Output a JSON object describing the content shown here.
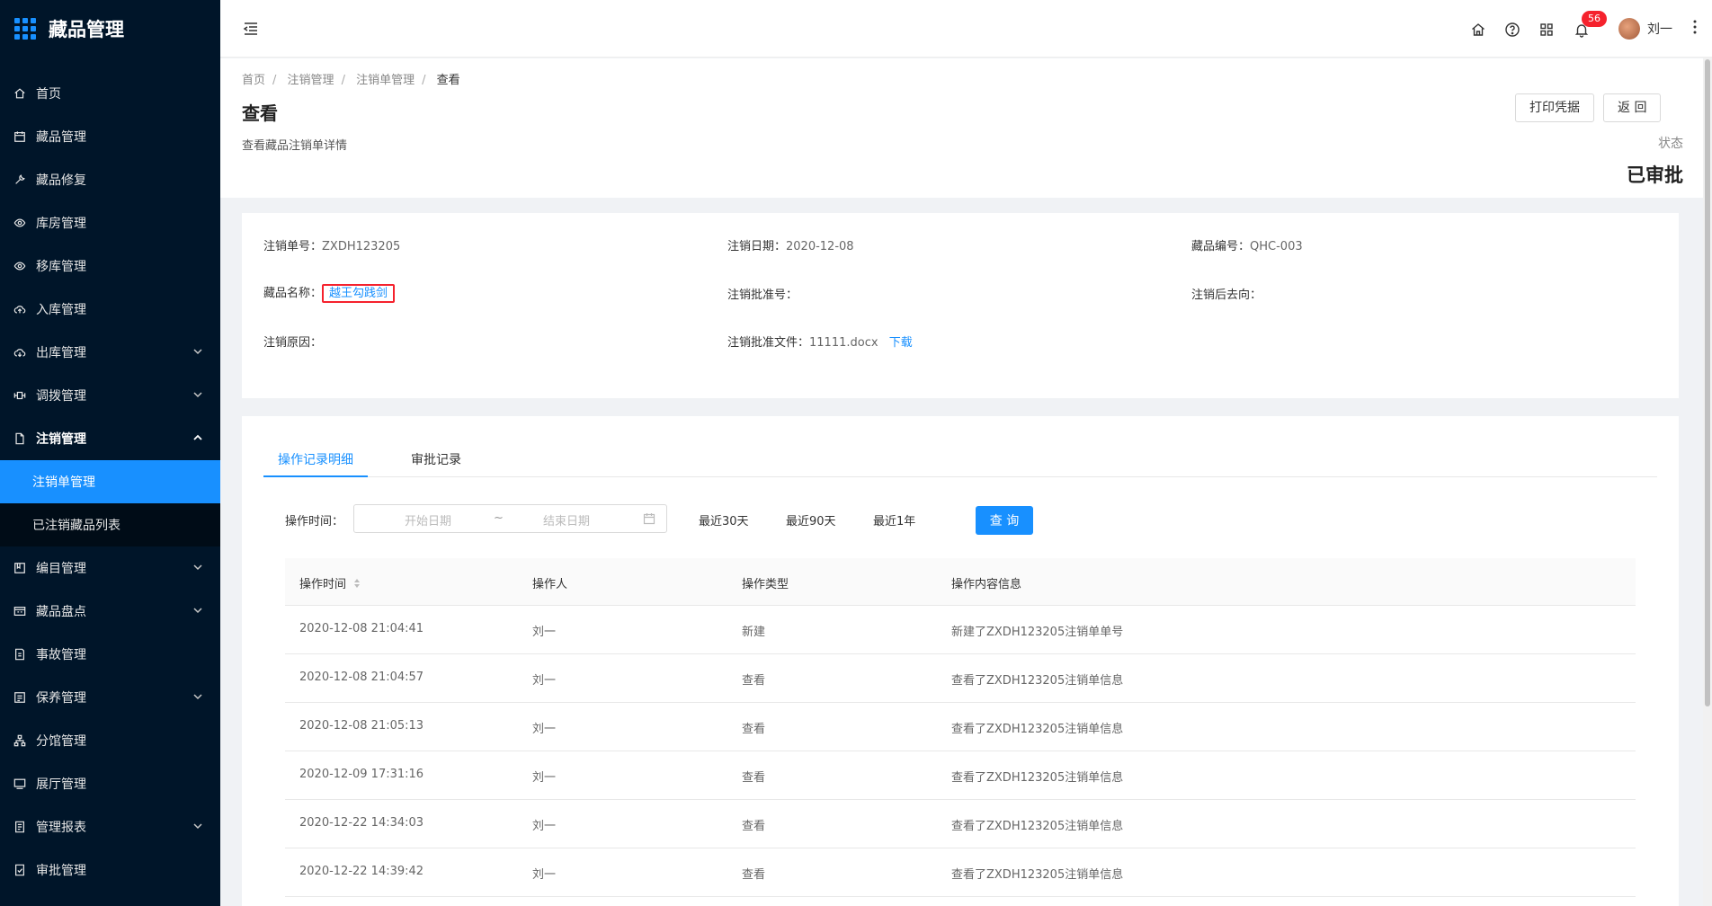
{
  "app": {
    "title": "藏品管理"
  },
  "sidebar": {
    "items": [
      {
        "label": "首页",
        "icon": "home-icon"
      },
      {
        "label": "藏品管理",
        "icon": "calendar-icon"
      },
      {
        "label": "藏品修复",
        "icon": "wrench-icon"
      },
      {
        "label": "库房管理",
        "icon": "eye-icon"
      },
      {
        "label": "移库管理",
        "icon": "eye-icon"
      },
      {
        "label": "入库管理",
        "icon": "cloud-upload-icon"
      },
      {
        "label": "出库管理",
        "icon": "cloud-download-icon",
        "arrow": "down"
      },
      {
        "label": "调拨管理",
        "icon": "swap-icon",
        "arrow": "down"
      },
      {
        "label": "注销管理",
        "icon": "file-icon",
        "arrow": "up"
      }
    ],
    "submenu": [
      {
        "label": "注销单管理",
        "active": true
      },
      {
        "label": "已注销藏品列表"
      }
    ],
    "items_after": [
      {
        "label": "编目管理",
        "icon": "catalog-icon",
        "arrow": "down"
      },
      {
        "label": "藏品盘点",
        "icon": "inventory-icon",
        "arrow": "down"
      },
      {
        "label": "事故管理",
        "icon": "accident-icon"
      },
      {
        "label": "保养管理",
        "icon": "maintenance-icon",
        "arrow": "down"
      },
      {
        "label": "分馆管理",
        "icon": "branch-icon"
      },
      {
        "label": "展厅管理",
        "icon": "hall-icon"
      },
      {
        "label": "管理报表",
        "icon": "report-icon",
        "arrow": "down"
      },
      {
        "label": "审批管理",
        "icon": "approval-icon"
      }
    ]
  },
  "header": {
    "notification_count": "56",
    "username": "刘一"
  },
  "breadcrumb": [
    "首页",
    "注销管理",
    "注销单管理",
    "查看"
  ],
  "page": {
    "title": "查看",
    "description": "查看藏品注销单详情",
    "print_label": "打印凭据",
    "back_label": "返 回",
    "status_label": "状态",
    "status_value": "已审批"
  },
  "detail": {
    "order_no_label": "注销单号：",
    "order_no": "ZXDH123205",
    "date_label": "注销日期：",
    "date": "2020-12-08",
    "code_label": "藏品编号：",
    "code": "QHC-003",
    "name_label": "藏品名称：",
    "name": "越王勾践剑",
    "approval_no_label": "注销批准号：",
    "destination_label": "注销后去向：",
    "reason_label": "注销原因：",
    "file_label": "注销批准文件：",
    "file_name": "11111.docx",
    "download_label": "下载"
  },
  "records": {
    "tabs": [
      "操作记录明细",
      "审批记录"
    ],
    "filter": {
      "label": "操作时间：",
      "start_placeholder": "开始日期",
      "end_placeholder": "结束日期",
      "quick": [
        "最近30天",
        "最近90天",
        "最近1年"
      ],
      "search_label": "查 询"
    },
    "columns": [
      "操作时间",
      "操作人",
      "操作类型",
      "操作内容信息"
    ],
    "rows": [
      [
        "2020-12-08 21:04:41",
        "刘一",
        "新建",
        "新建了ZXDH123205注销单单号"
      ],
      [
        "2020-12-08 21:04:57",
        "刘一",
        "查看",
        "查看了ZXDH123205注销单信息"
      ],
      [
        "2020-12-08 21:05:13",
        "刘一",
        "查看",
        "查看了ZXDH123205注销单信息"
      ],
      [
        "2020-12-09 17:31:16",
        "刘一",
        "查看",
        "查看了ZXDH123205注销单信息"
      ],
      [
        "2020-12-22 14:34:03",
        "刘一",
        "查看",
        "查看了ZXDH123205注销单信息"
      ],
      [
        "2020-12-22 14:39:42",
        "刘一",
        "查看",
        "查看了ZXDH123205注销单信息"
      ]
    ]
  },
  "colors": {
    "primary": "#1890ff",
    "sidebar_bg": "#001529",
    "badge": "#f5222d"
  }
}
